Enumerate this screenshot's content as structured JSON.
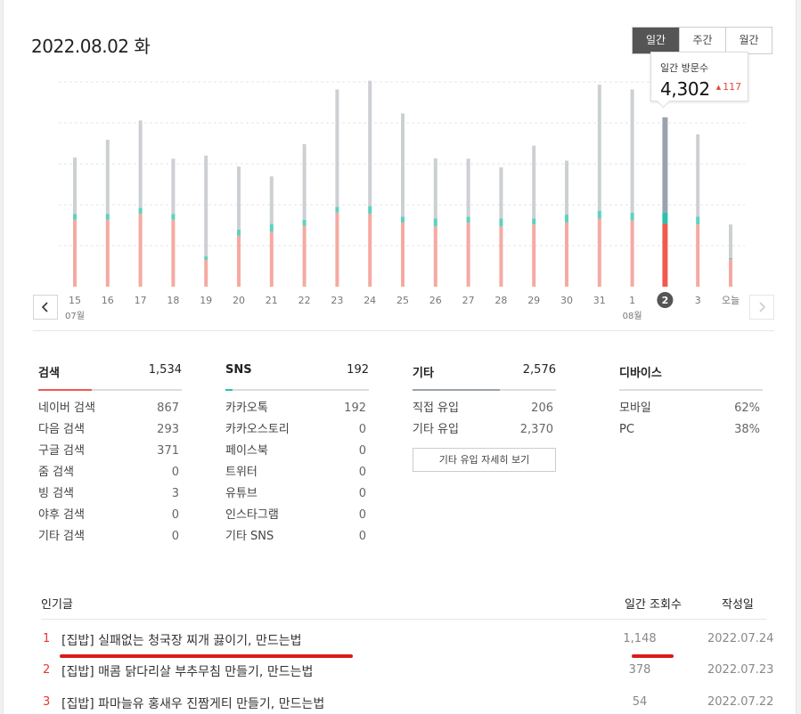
{
  "header": {
    "date_title": "2022.08.02 화"
  },
  "tabs": [
    {
      "label": "일간",
      "active": true
    },
    {
      "label": "주간",
      "active": false
    },
    {
      "label": "월간",
      "active": false
    }
  ],
  "tooltip": {
    "label": "일간 방문수",
    "value": "4,302",
    "change": "117",
    "change_direction": "up"
  },
  "colors": {
    "search": "#f5aaa1",
    "search_selected": "#ef5a4f",
    "sns": "#5ed1c1",
    "sns_selected": "#2bc1ad",
    "other": "#cdd0d3",
    "other_selected": "#9aa3ad",
    "accent_red": "#e53935"
  },
  "chart_data": {
    "type": "bar",
    "stacked": true,
    "categories": [
      "15",
      "16",
      "17",
      "18",
      "19",
      "20",
      "21",
      "22",
      "23",
      "24",
      "25",
      "26",
      "27",
      "28",
      "29",
      "30",
      "31",
      "1",
      "2",
      "3",
      "오늘"
    ],
    "month_labels": [
      {
        "index": 0,
        "label": "07월"
      },
      {
        "index": 17,
        "label": "08월"
      }
    ],
    "selected_index": 18,
    "series": [
      {
        "values": [
          1700,
          1700,
          1850,
          1700,
          680,
          1300,
          1400,
          1550,
          1880,
          1850,
          1630,
          1530,
          1630,
          1530,
          1580,
          1630,
          1730,
          1680,
          1595,
          1580,
          700
        ]
      },
      {
        "values": [
          150,
          150,
          150,
          150,
          90,
          150,
          200,
          150,
          150,
          200,
          150,
          200,
          150,
          200,
          150,
          200,
          200,
          200,
          290,
          200,
          30
        ]
      },
      {
        "values": [
          1430,
          1880,
          2220,
          1400,
          2560,
          1600,
          1200,
          1920,
          2980,
          3180,
          2620,
          1530,
          1470,
          1300,
          1850,
          1370,
          3200,
          3130,
          2417,
          2090,
          850
        ]
      }
    ],
    "ylim": [
      0,
      5200
    ],
    "grid": true
  },
  "nav": {
    "prev_icon": "chevron-left-icon",
    "next_icon": "chevron-right-icon"
  },
  "stats": {
    "search": {
      "title": "검색",
      "total": "1,534",
      "fill": 0.37,
      "color": "#ef5a4f",
      "rows": [
        {
          "label": "네이버 검색",
          "value": "867"
        },
        {
          "label": "다음 검색",
          "value": "293"
        },
        {
          "label": "구글 검색",
          "value": "371"
        },
        {
          "label": "줌 검색",
          "value": "0"
        },
        {
          "label": "빙 검색",
          "value": "3"
        },
        {
          "label": "야후 검색",
          "value": "0"
        },
        {
          "label": "기타 검색",
          "value": "0"
        }
      ]
    },
    "sns": {
      "title": "SNS",
      "total": "192",
      "fill": 0.05,
      "color": "#2bc1ad",
      "rows": [
        {
          "label": "카카오톡",
          "value": "192"
        },
        {
          "label": "카카오스토리",
          "value": "0"
        },
        {
          "label": "페이스북",
          "value": "0"
        },
        {
          "label": "트위터",
          "value": "0"
        },
        {
          "label": "유튜브",
          "value": "0"
        },
        {
          "label": "인스타그램",
          "value": "0"
        },
        {
          "label": "기타 SNS",
          "value": "0"
        }
      ]
    },
    "other": {
      "title": "기타",
      "total": "2,576",
      "fill": 0.61,
      "color": "#9aa3ad",
      "rows": [
        {
          "label": "직접 유입",
          "value": "206"
        },
        {
          "label": "기타 유입",
          "value": "2,370"
        }
      ],
      "detail_button": "기타 유입 자세히 보기"
    },
    "device": {
      "title": "디바이스",
      "rows": [
        {
          "label": "모바일",
          "value": "62%"
        },
        {
          "label": "PC",
          "value": "38%"
        }
      ]
    }
  },
  "popular": {
    "header": {
      "title": "인기글",
      "views": "일간 조회수",
      "date": "작성일"
    },
    "rows": [
      {
        "rank": "1",
        "title": "[집밥] 실패없는 청국장 찌개 끓이기, 만드는법",
        "views": "1,148",
        "date": "2022.07.24"
      },
      {
        "rank": "2",
        "title": "[집밥] 매콤 닭다리살 부추무침 만들기, 만드는법",
        "views": "378",
        "date": "2022.07.23"
      },
      {
        "rank": "3",
        "title": "[집밥] 파마늘유 홍새우 진짬게티 만들기, 만드는법",
        "views": "54",
        "date": "2022.07.22"
      }
    ]
  }
}
